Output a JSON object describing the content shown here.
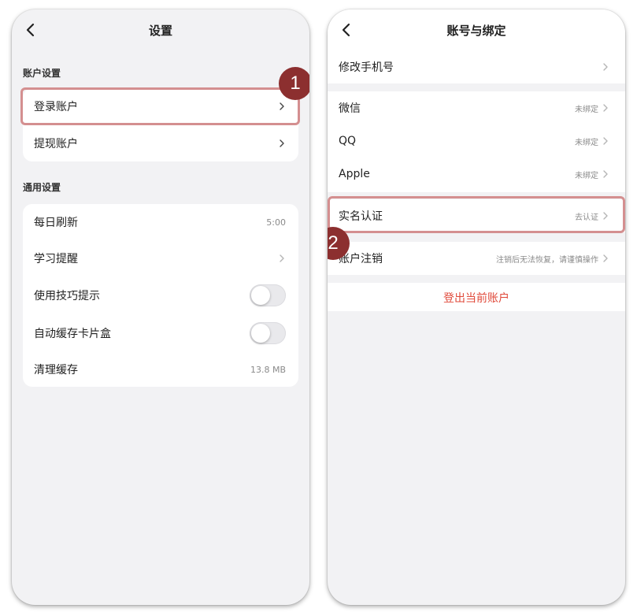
{
  "left": {
    "title": "设置",
    "account_section": {
      "label": "账户设置",
      "items": [
        {
          "label": "登录账户"
        },
        {
          "label": "提现账户"
        }
      ]
    },
    "general_section": {
      "label": "通用设置",
      "items": [
        {
          "label": "每日刷新",
          "value": "5:00"
        },
        {
          "label": "学习提醒"
        },
        {
          "label": "使用技巧提示",
          "toggle": "off"
        },
        {
          "label": "自动缓存卡片盒",
          "toggle": "off"
        },
        {
          "label": "清理缓存",
          "value": "13.8 MB"
        }
      ]
    },
    "badge": "1"
  },
  "right": {
    "title": "账号与绑定",
    "phone_item": {
      "label": "修改手机号"
    },
    "bind_items": [
      {
        "label": "微信",
        "value": "未绑定"
      },
      {
        "label": "QQ",
        "value": "未绑定"
      },
      {
        "label": "Apple",
        "value": "未绑定"
      }
    ],
    "verify_item": {
      "label": "实名认证",
      "value": "去认证"
    },
    "cancel_item": {
      "label": "账户注销",
      "value": "注销后无法恢复，请谨慎操作"
    },
    "logout_label": "登出当前账户",
    "badge": "2"
  },
  "colors": {
    "highlight": "#d48f90",
    "badge": "#8c2f2f",
    "logout": "#e0493a",
    "background": "#f2f2f4"
  }
}
